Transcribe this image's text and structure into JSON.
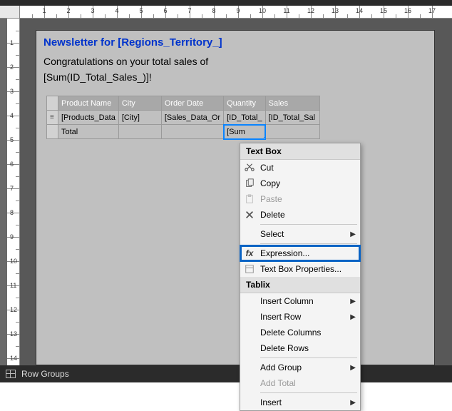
{
  "ruler": {
    "h_numbers": [
      1,
      2,
      3,
      4,
      5,
      6,
      7,
      8,
      9,
      10,
      11,
      12,
      13,
      14,
      15,
      16,
      17
    ],
    "v_numbers": [
      1,
      2,
      3,
      4,
      5,
      6,
      7,
      8,
      9,
      10,
      11,
      12,
      13,
      14
    ]
  },
  "report": {
    "title": "Newsletter for [Regions_Territory_]",
    "body_line1": "Congratulations on your total sales of",
    "body_line2": "[Sum(ID_Total_Sales_)]!"
  },
  "tablix": {
    "headers": [
      "Product Name",
      "City",
      "Order Date",
      "Quantity",
      "Sales"
    ],
    "row1": [
      "[Products_Data",
      "[City]",
      "[Sales_Data_Or",
      "[ID_Total_",
      "[ID_Total_Sal"
    ],
    "row2": [
      "Total",
      "",
      "",
      "[Sum",
      ""
    ]
  },
  "context_menu": {
    "header1": "Text Box",
    "items1": [
      {
        "icon": "cut-icon",
        "label": "Cut",
        "disabled": false
      },
      {
        "icon": "copy-icon",
        "label": "Copy",
        "disabled": false
      },
      {
        "icon": "paste-icon",
        "label": "Paste",
        "disabled": true
      },
      {
        "icon": "delete-icon",
        "label": "Delete",
        "disabled": false
      }
    ],
    "select_label": "Select",
    "expression_label": "Expression...",
    "textbox_props_label": "Text Box Properties...",
    "header2": "Tablix",
    "insert_column": "Insert Column",
    "insert_row": "Insert Row",
    "delete_columns": "Delete Columns",
    "delete_rows": "Delete Rows",
    "add_group": "Add Group",
    "add_total": "Add Total",
    "insert": "Insert"
  },
  "bottom_bar": {
    "label": "Row Groups"
  }
}
